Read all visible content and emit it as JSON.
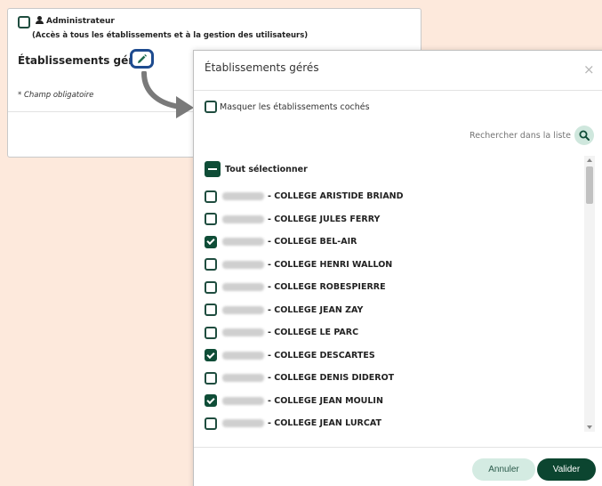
{
  "background_form": {
    "admin_label": "Administrateur",
    "admin_sub": "(Accès à tous les établissements et à la gestion des utilisateurs)",
    "title": "Établissements gérés",
    "required_note": "* Champ obligatoire"
  },
  "modal": {
    "title": "Établissements gérés",
    "close": "×",
    "hide_checked_label": "Masquer les établissements cochés",
    "search_placeholder": "Rechercher dans la liste",
    "select_all_label": "Tout sélectionner",
    "items": [
      {
        "name": "- COLLEGE ARISTIDE BRIAND",
        "checked": false
      },
      {
        "name": "- COLLEGE JULES FERRY",
        "checked": false
      },
      {
        "name": "- COLLEGE BEL-AIR",
        "checked": true
      },
      {
        "name": "- COLLEGE HENRI WALLON",
        "checked": false
      },
      {
        "name": "- COLLEGE ROBESPIERRE",
        "checked": false
      },
      {
        "name": "- COLLEGE JEAN ZAY",
        "checked": false
      },
      {
        "name": "- COLLEGE LE PARC",
        "checked": false
      },
      {
        "name": "- COLLEGE DESCARTES",
        "checked": true
      },
      {
        "name": "- COLLEGE DENIS DIDEROT",
        "checked": false
      },
      {
        "name": "- COLLEGE JEAN MOULIN",
        "checked": true
      },
      {
        "name": "- COLLEGE JEAN LURCAT",
        "checked": false
      }
    ],
    "cancel_label": "Annuler",
    "validate_label": "Valider"
  },
  "colors": {
    "page_background": "#fde9dc",
    "accent_dark_green": "#0c4530",
    "accent_light_green": "#d4ebe2",
    "edit_border_blue": "#1e4b8f"
  }
}
